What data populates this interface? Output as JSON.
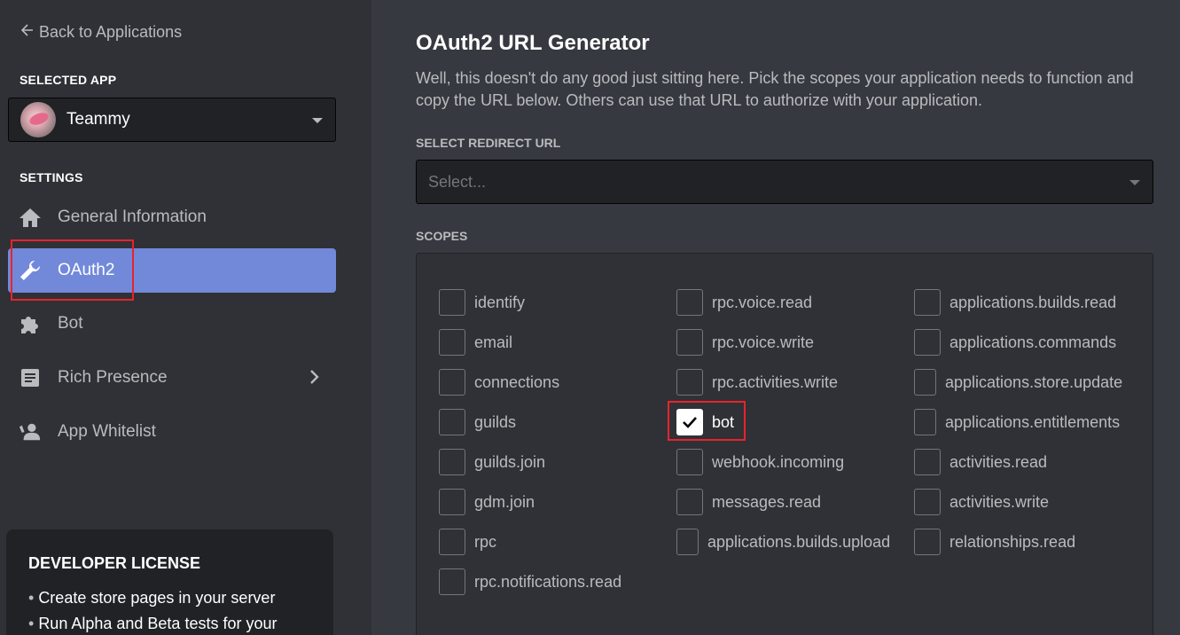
{
  "sidebar": {
    "back_label": "Back to Applications",
    "selected_app_label": "SELECTED APP",
    "app_name": "Teammy",
    "settings_label": "SETTINGS",
    "items": [
      {
        "label": "General Information",
        "icon": "home-icon"
      },
      {
        "label": "OAuth2",
        "icon": "wrench-icon",
        "active": true
      },
      {
        "label": "Bot",
        "icon": "puzzle-icon"
      },
      {
        "label": "Rich Presence",
        "icon": "document-icon"
      },
      {
        "label": "App Whitelist",
        "icon": "user-icon"
      }
    ],
    "license": {
      "title": "DEVELOPER LICENSE",
      "items": [
        "Create store pages in your server",
        "Run Alpha and Beta tests for your"
      ]
    }
  },
  "main": {
    "title": "OAuth2 URL Generator",
    "description": "Well, this doesn't do any good just sitting here. Pick the scopes your application needs to function and copy the URL below. Others can use that URL to authorize with your application.",
    "redirect_label": "SELECT REDIRECT URL",
    "redirect_placeholder": "Select...",
    "scopes_label": "SCOPES",
    "scopes": {
      "col1": [
        "identify",
        "email",
        "connections",
        "guilds",
        "guilds.join",
        "gdm.join",
        "rpc",
        "rpc.notifications.read"
      ],
      "col2": [
        "rpc.voice.read",
        "rpc.voice.write",
        "rpc.activities.write",
        "bot",
        "webhook.incoming",
        "messages.read",
        "applications.builds.upload"
      ],
      "col3": [
        "applications.builds.read",
        "applications.commands",
        "applications.store.update",
        "applications.entitlements",
        "activities.read",
        "activities.write",
        "relationships.read"
      ],
      "checked": [
        "bot"
      ]
    }
  },
  "colors": {
    "accent": "#7289da",
    "highlight": "#e8232d",
    "background": "#36393f",
    "sidebar": "#2f3136"
  }
}
